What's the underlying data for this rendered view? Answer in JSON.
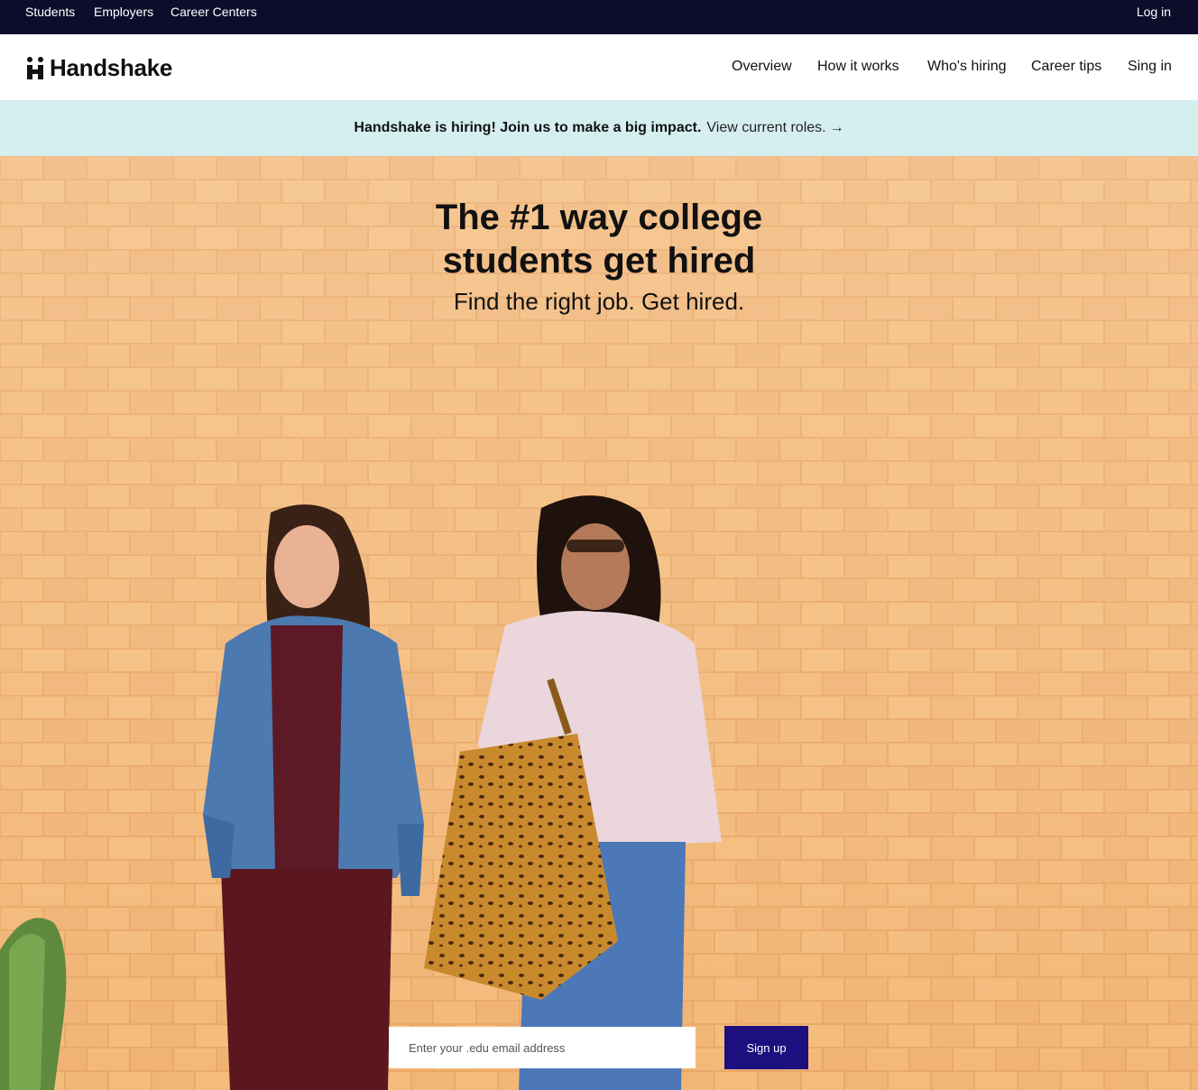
{
  "utility_nav": {
    "students": "Students",
    "employers": "Employers",
    "career_centers": "Career Centers",
    "login": "Log in"
  },
  "header": {
    "logo_text": "Handshake",
    "nav": {
      "overview": "Overview",
      "how_it_works": "How it works",
      "whos_hiring": "Who's hiring",
      "career_tips": "Career tips",
      "sign_in": "Sing in"
    }
  },
  "banner": {
    "strong_text": "Handshake is hiring! Join us to make a big impact.",
    "link_text": "View current roles.",
    "arrow": "→"
  },
  "hero": {
    "title": "The #1 way college students get hired",
    "subtitle": "Find the right job. Get hired.",
    "email_placeholder": "Enter your .edu email address",
    "signup_label": "Sign up"
  },
  "colors": {
    "utility_bar": "#0d0c2b",
    "banner_bg": "#d5eff0",
    "signup_button": "#1d0f7e",
    "brick": "#f0b071"
  }
}
